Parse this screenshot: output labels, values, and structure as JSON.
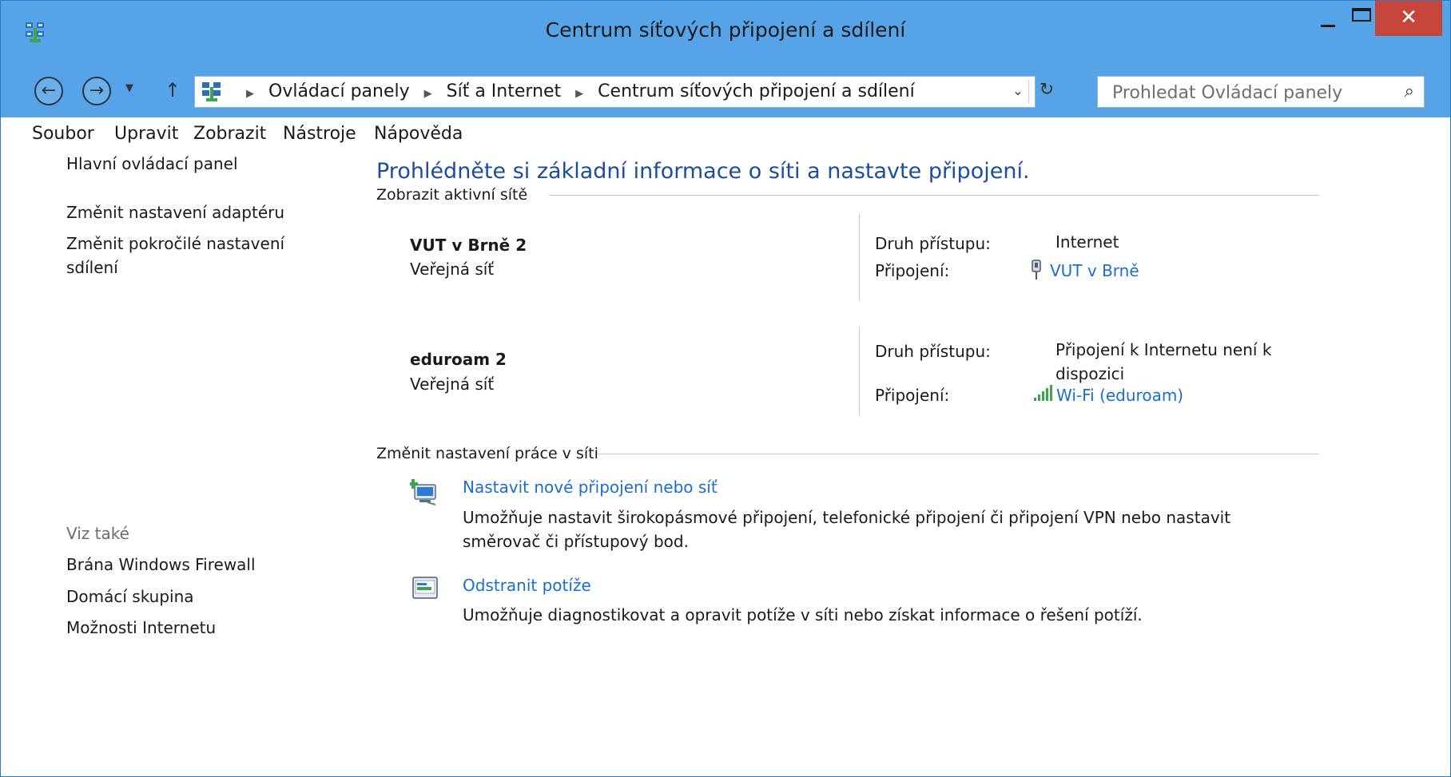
{
  "window": {
    "title": "Centrum síťových připojení a sdílení",
    "controls": {
      "minimize": "—",
      "maximize": "☐",
      "close": "✕"
    }
  },
  "navigation": {
    "back_icon": "←",
    "forward_icon": "→",
    "dropdown_icon": "▼",
    "up_icon": "↑"
  },
  "address": {
    "crumbs": [
      "Ovládací panely",
      "Síť a Internet",
      "Centrum síťových připojení a sdílení"
    ],
    "separator": "▶",
    "dropdown": "⌄",
    "refresh": "↻"
  },
  "search": {
    "placeholder": "Prohledat Ovládací panely",
    "icon": "⌕"
  },
  "menu": {
    "items": [
      "Soubor",
      "Upravit",
      "Zobrazit",
      "Nástroje",
      "Nápověda"
    ]
  },
  "sidebar": {
    "home": "Hlavní ovládací panel",
    "links": [
      "Změnit nastavení adaptéru",
      "Změnit pokročilé nastavení sdílení"
    ],
    "see_also_header": "Viz také",
    "see_also": [
      "Brána Windows Firewall",
      "Domácí skupina",
      "Možnosti Internetu"
    ]
  },
  "main": {
    "title": "Prohlédněte si základní informace o síti a nastavte připojení.",
    "active_networks_header": "Zobrazit aktivní sítě",
    "networks": [
      {
        "name": "VUT v Brně  2",
        "type": "Veřejná síť",
        "access_label": "Druh přístupu:",
        "access_value": "Internet",
        "connection_label": "Připojení:",
        "connection_value": "VUT v Brně",
        "connection_icon": "ethernet-icon"
      },
      {
        "name": "eduroam  2",
        "type": "Veřejná síť",
        "access_label": "Druh přístupu:",
        "access_value": "Připojení k Internetu není k dispozici",
        "connection_label": "Připojení:",
        "connection_value": "Wi-Fi (eduroam)",
        "connection_icon": "wifi-signal-icon"
      }
    ],
    "change_settings_header": "Změnit nastavení práce v síti",
    "tasks": [
      {
        "link": "Nastavit nové připojení nebo síť",
        "description": "Umožňuje nastavit širokopásmové připojení, telefonické připojení či připojení VPN nebo nastavit směrovač či přístupový bod.",
        "icon": "new-connection-icon"
      },
      {
        "link": "Odstranit potíže",
        "description": "Umožňuje diagnostikovat a opravit potíže v síti nebo získat informace o řešení potíží.",
        "icon": "troubleshoot-icon"
      }
    ]
  },
  "colors": {
    "titlebar": "#57a3e8",
    "close": "#c7463c",
    "link": "#1a6ed2",
    "heading": "#1e4d9a"
  }
}
